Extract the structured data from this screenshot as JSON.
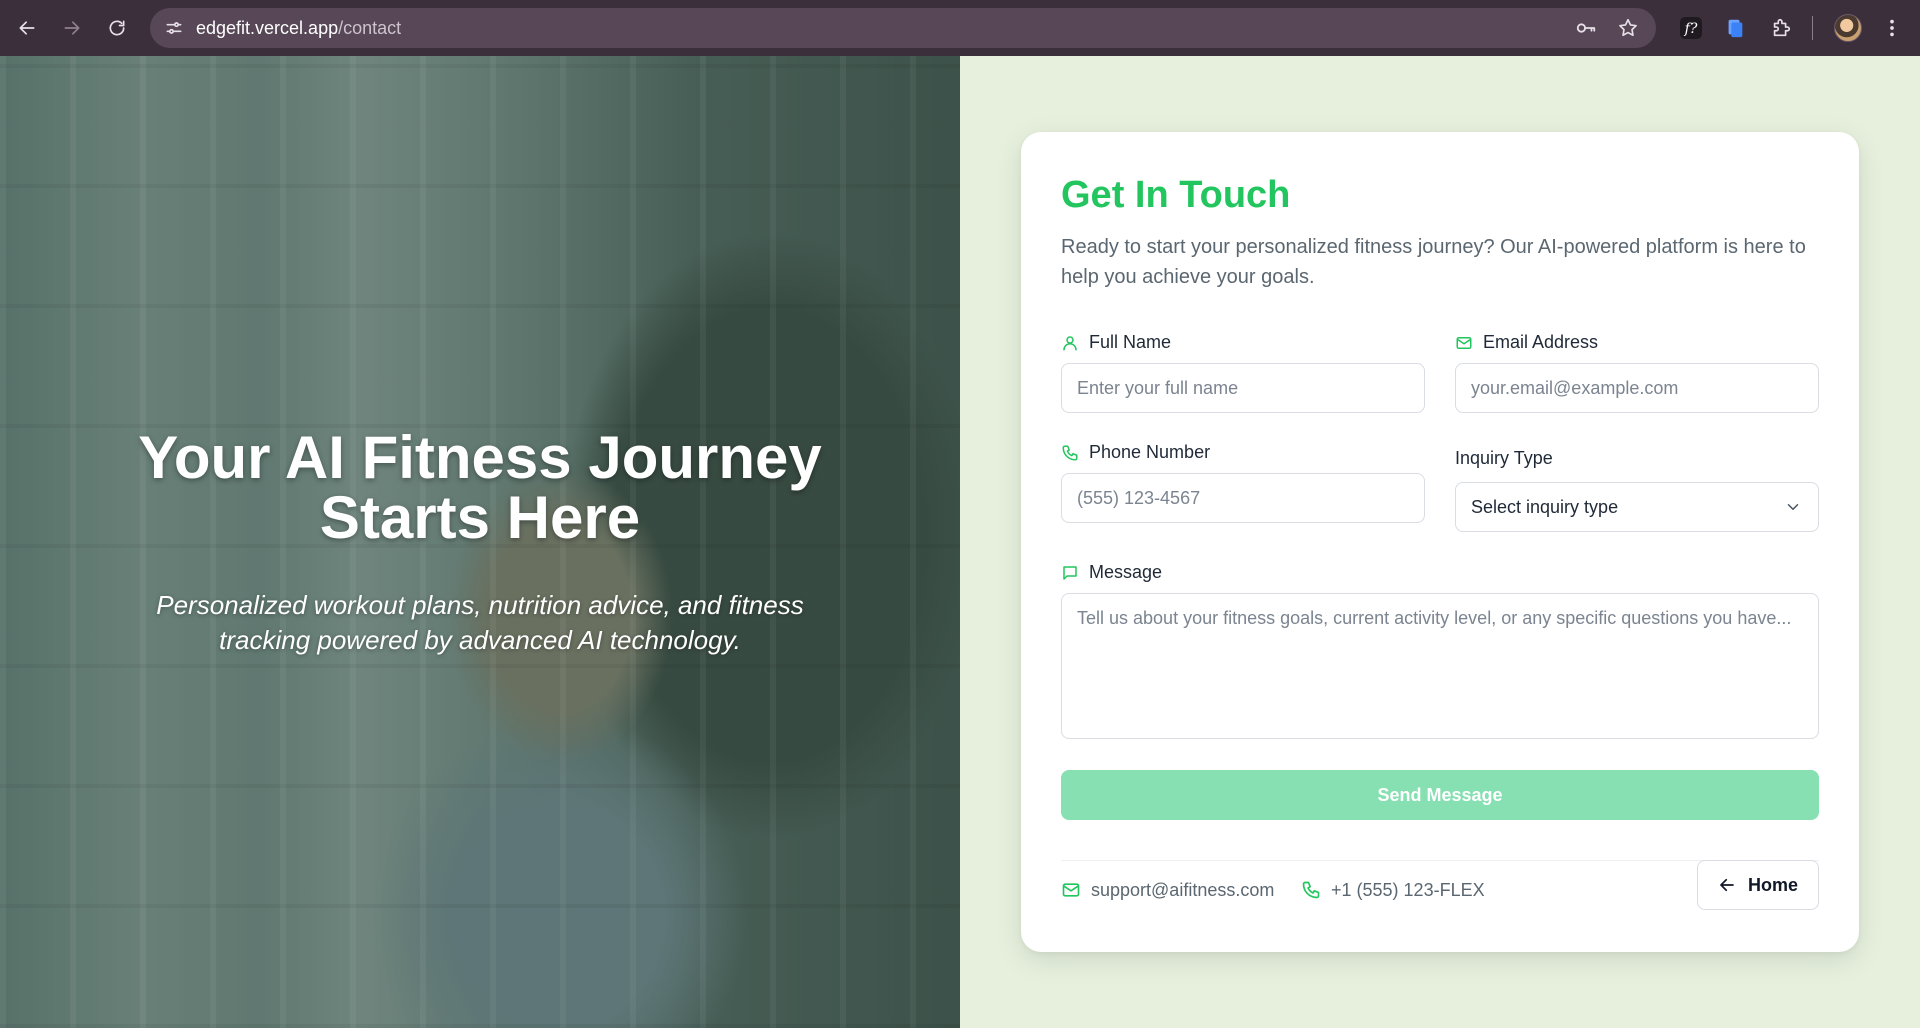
{
  "browser": {
    "url_host": "edgefit.vercel.app",
    "url_path": "/contact",
    "icons": [
      "back-icon",
      "forward-icon",
      "reload-icon",
      "site-info-icon",
      "password-key-icon",
      "bookmark-star-icon",
      "extension-f-icon",
      "extension-doc-icon",
      "extensions-puzzle-icon",
      "profile-avatar",
      "menu-dots-icon"
    ]
  },
  "hero": {
    "title": "Your AI Fitness Journey Starts Here",
    "subtitle": "Personalized workout plans, nutrition advice, and fitness tracking powered by advanced AI technology."
  },
  "contact": {
    "title": "Get In Touch",
    "description": "Ready to start your personalized fitness journey? Our AI-powered platform is here to help you achieve your goals.",
    "full_name": {
      "label": "Full Name",
      "placeholder": "Enter your full name",
      "value": ""
    },
    "email": {
      "label": "Email Address",
      "placeholder": "your.email@example.com",
      "value": ""
    },
    "phone": {
      "label": "Phone Number",
      "placeholder": "(555) 123-4567",
      "value": ""
    },
    "inquiry": {
      "label": "Inquiry Type",
      "selected": "Select inquiry type"
    },
    "message": {
      "label": "Message",
      "placeholder": "Tell us about your fitness goals, current activity level, or any specific questions you have...",
      "value": ""
    },
    "send_label": "Send Message",
    "support_email": "support@aifitness.com",
    "support_phone": "+1 (555) 123-FLEX",
    "home_label": "Home"
  },
  "colors": {
    "accent": "#22c55e",
    "send_button_disabled": "#86e0b2",
    "page_background": "#e6f0dd",
    "browser_chrome": "#3c2f3c"
  }
}
